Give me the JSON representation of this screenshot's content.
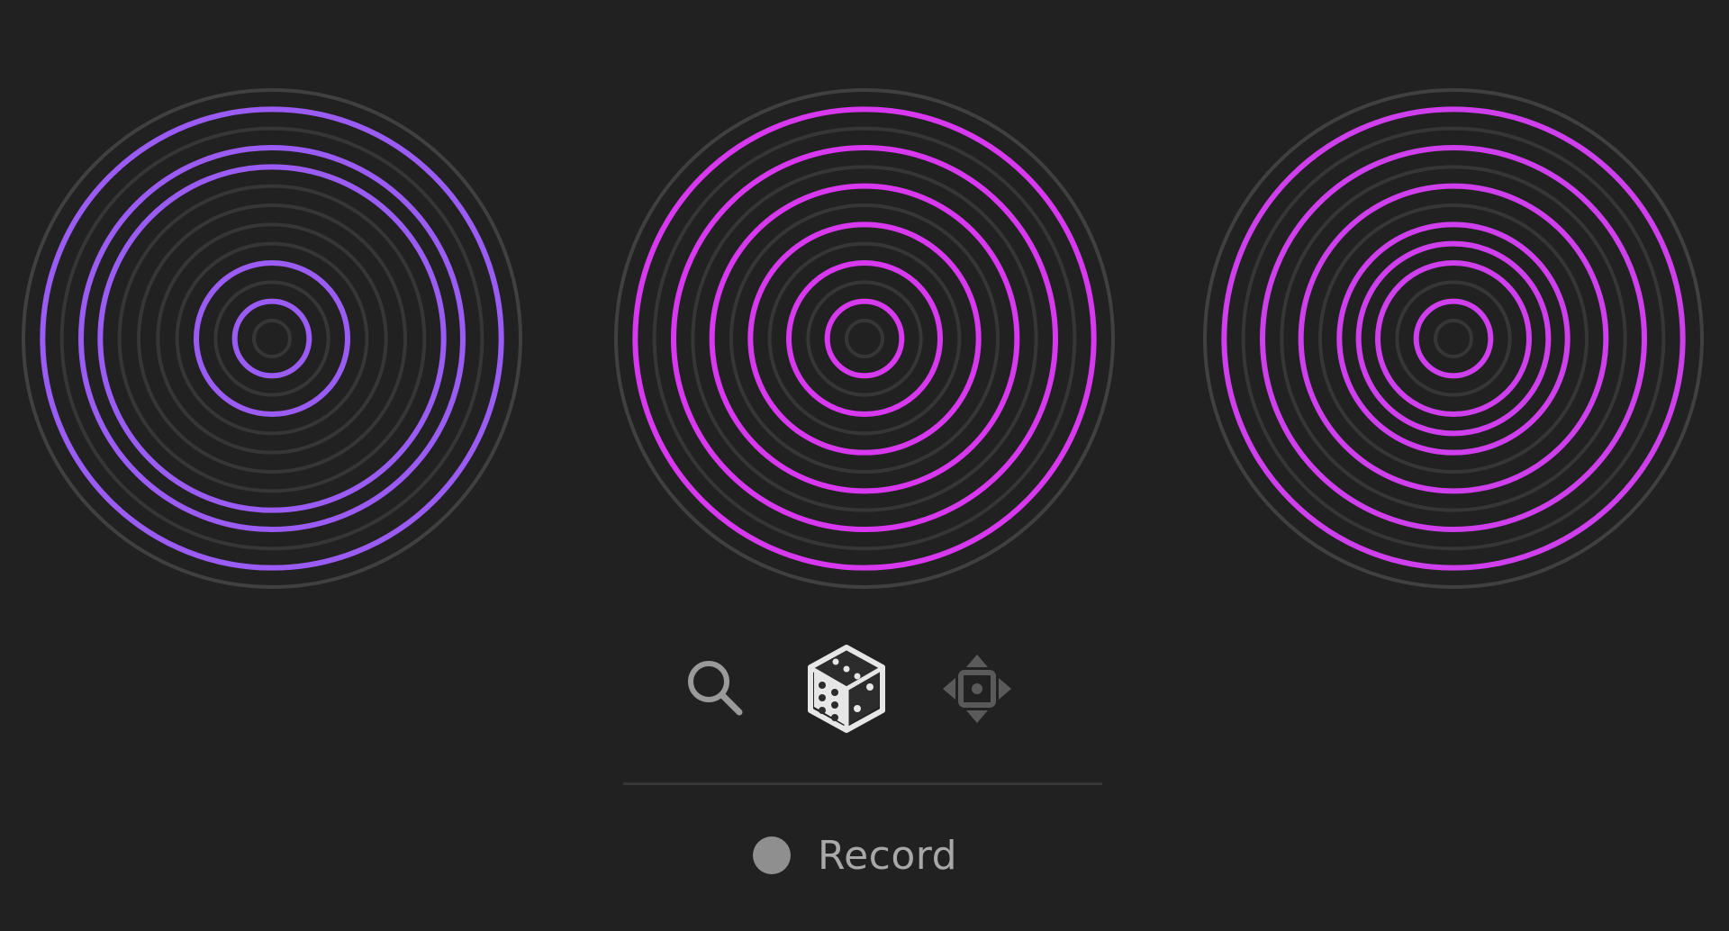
{
  "colors": {
    "background": "#212121",
    "ring_idle": "#363636",
    "ring_outer": "#404040",
    "dial_1_accent": "#9b5cf6",
    "dial_2_accent": "#d838f0",
    "dial_3_accent": "#cf3fee",
    "icon_idle": "#9a9a9a",
    "icon_active": "#e6e6e6",
    "record_dot": "#8f8f8f",
    "record_text": "#a8a8a8"
  },
  "dials": [
    {
      "name": "dial-1",
      "ring_count": 12,
      "active_rings": [
        1,
        3,
        4,
        9,
        11
      ]
    },
    {
      "name": "dial-2",
      "ring_count": 12,
      "active_rings": [
        1,
        3,
        5,
        7,
        9,
        11
      ]
    },
    {
      "name": "dial-3",
      "ring_count": 12,
      "active_rings": [
        1,
        3,
        5,
        7,
        8,
        9,
        11
      ]
    }
  ],
  "toolbar": {
    "items": [
      {
        "name": "search",
        "icon": "magnifier-icon",
        "active": false
      },
      {
        "name": "random",
        "icon": "dice-icon",
        "active": true
      },
      {
        "name": "move",
        "icon": "move-arrows-icon",
        "active": false
      }
    ]
  },
  "record": {
    "label": "Record",
    "icon": "record-dot-icon"
  }
}
